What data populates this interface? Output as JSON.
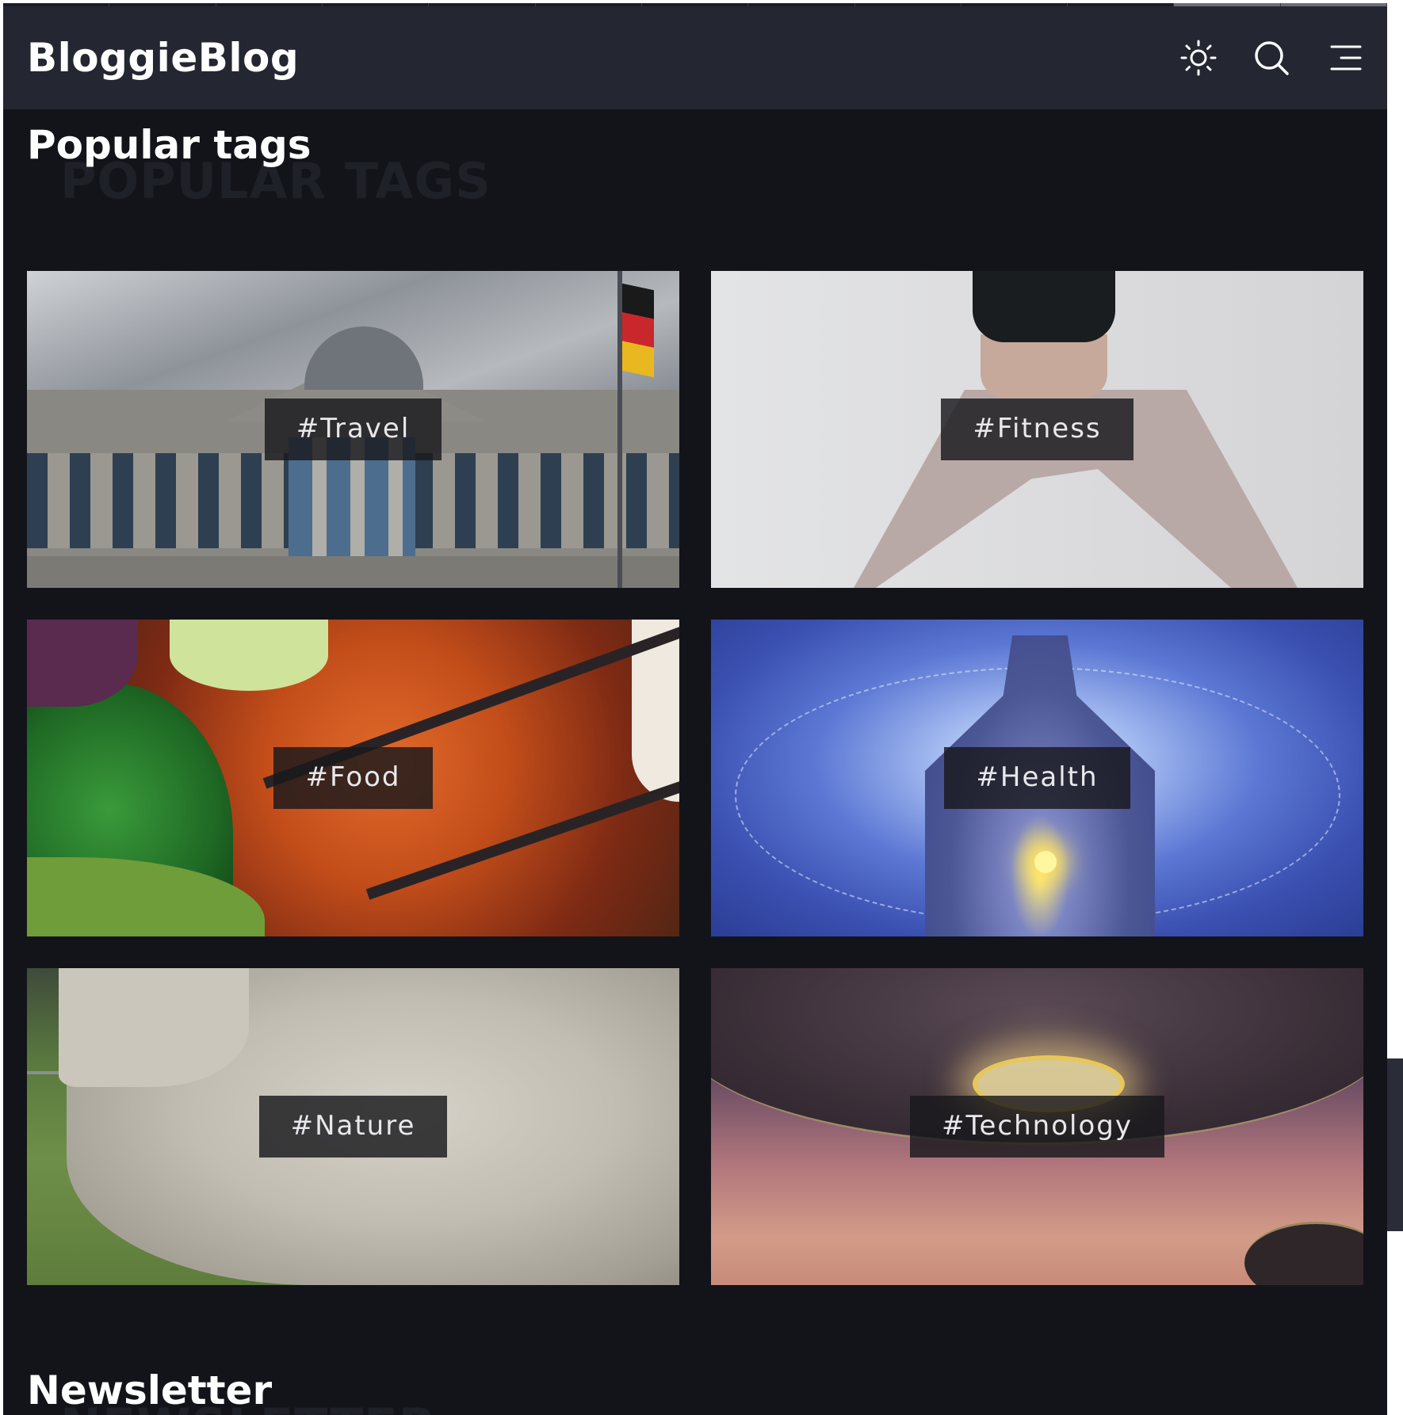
{
  "header": {
    "logo": "BloggieBlog",
    "icons": [
      "sun-icon",
      "search-icon",
      "menu-icon"
    ]
  },
  "popular_tags": {
    "title": "Popular tags",
    "ghost_title": "Popular tags",
    "tags": [
      {
        "label": "#Travel"
      },
      {
        "label": "#Fitness"
      },
      {
        "label": "#Food"
      },
      {
        "label": "#Health"
      },
      {
        "label": "#Nature"
      },
      {
        "label": "#Technology"
      }
    ]
  },
  "newsletter": {
    "title": "Newsletter",
    "ghost_title": "Newsletter"
  },
  "colors": {
    "page_bg": "#131419",
    "header_bg": "#242731",
    "tag_label_bg": "#18181c",
    "text": "#ffffff"
  }
}
